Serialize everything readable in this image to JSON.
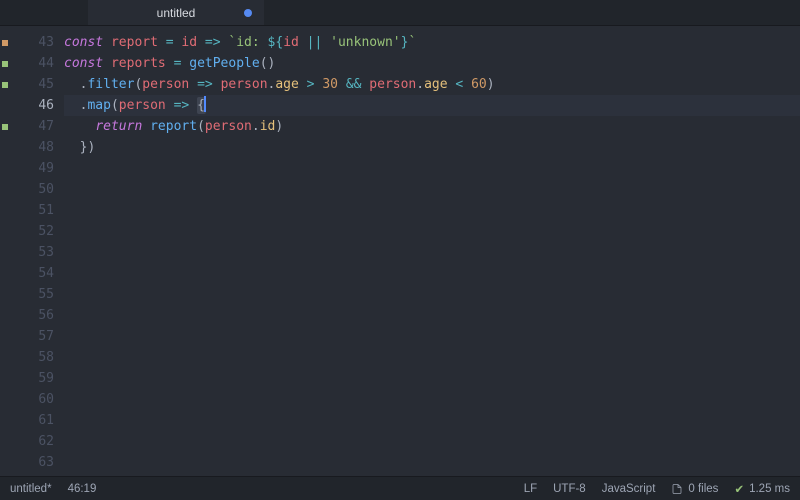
{
  "tab": {
    "title": "untitled",
    "modified": true
  },
  "gutter": {
    "start": 43,
    "end": 63,
    "active": 46,
    "markers": {
      "43": "#d19a66",
      "44": "#98c379",
      "45": "#98c379",
      "47": "#98c379"
    }
  },
  "code": {
    "lines": [
      {
        "n": 43,
        "tokens": [
          [
            "kw",
            "const"
          ],
          [
            "pn",
            " "
          ],
          [
            "vr",
            "report"
          ],
          [
            "pn",
            " "
          ],
          [
            "op",
            "="
          ],
          [
            "pn",
            " "
          ],
          [
            "vr",
            "id"
          ],
          [
            "pn",
            " "
          ],
          [
            "op",
            "=>"
          ],
          [
            "pn",
            " "
          ],
          [
            "st",
            "`id: "
          ],
          [
            "tm",
            "${"
          ],
          [
            "vr",
            "id"
          ],
          [
            "pn",
            " "
          ],
          [
            "op",
            "||"
          ],
          [
            "pn",
            " "
          ],
          [
            "st",
            "'unknown'"
          ],
          [
            "tm",
            "}"
          ],
          [
            "st",
            "`"
          ]
        ]
      },
      {
        "n": 44,
        "tokens": [
          [
            "kw",
            "const"
          ],
          [
            "pn",
            " "
          ],
          [
            "vr",
            "reports"
          ],
          [
            "pn",
            " "
          ],
          [
            "op",
            "="
          ],
          [
            "pn",
            " "
          ],
          [
            "fn",
            "getPeople"
          ],
          [
            "pn",
            "()"
          ]
        ]
      },
      {
        "n": 45,
        "tokens": [
          [
            "pn",
            "  "
          ],
          [
            "pn",
            "."
          ],
          [
            "fn",
            "filter"
          ],
          [
            "pn",
            "("
          ],
          [
            "vr",
            "person"
          ],
          [
            "pn",
            " "
          ],
          [
            "op",
            "=>"
          ],
          [
            "pn",
            " "
          ],
          [
            "vr",
            "person"
          ],
          [
            "pn",
            "."
          ],
          [
            "pr",
            "age"
          ],
          [
            "pn",
            " "
          ],
          [
            "op",
            ">"
          ],
          [
            "pn",
            " "
          ],
          [
            "nm",
            "30"
          ],
          [
            "pn",
            " "
          ],
          [
            "op",
            "&&"
          ],
          [
            "pn",
            " "
          ],
          [
            "vr",
            "person"
          ],
          [
            "pn",
            "."
          ],
          [
            "pr",
            "age"
          ],
          [
            "pn",
            " "
          ],
          [
            "op",
            "<"
          ],
          [
            "pn",
            " "
          ],
          [
            "nm",
            "60"
          ],
          [
            "pn",
            ")"
          ]
        ]
      },
      {
        "n": 46,
        "hl": true,
        "tokens": [
          [
            "pn",
            "  "
          ],
          [
            "pn",
            "."
          ],
          [
            "fn",
            "map"
          ],
          [
            "pn",
            "("
          ],
          [
            "vr",
            "person"
          ],
          [
            "pn",
            " "
          ],
          [
            "op",
            "=>"
          ],
          [
            "pn",
            " "
          ],
          [
            "sel-open",
            ""
          ],
          [
            "pn",
            "{"
          ],
          [
            "cursor",
            ""
          ],
          [
            "sel-close",
            ""
          ]
        ]
      },
      {
        "n": 47,
        "tokens": [
          [
            "pn",
            "    "
          ],
          [
            "kw",
            "return"
          ],
          [
            "pn",
            " "
          ],
          [
            "fn",
            "report"
          ],
          [
            "pn",
            "("
          ],
          [
            "vr",
            "person"
          ],
          [
            "pn",
            "."
          ],
          [
            "pr",
            "id"
          ],
          [
            "pn",
            ")"
          ]
        ]
      },
      {
        "n": 48,
        "tokens": [
          [
            "pn",
            "  "
          ],
          [
            "pn",
            "})"
          ]
        ]
      },
      {
        "n": 49,
        "tokens": []
      },
      {
        "n": 50,
        "tokens": []
      },
      {
        "n": 51,
        "tokens": []
      },
      {
        "n": 52,
        "tokens": []
      },
      {
        "n": 53,
        "tokens": []
      },
      {
        "n": 54,
        "tokens": []
      },
      {
        "n": 55,
        "tokens": []
      },
      {
        "n": 56,
        "tokens": []
      },
      {
        "n": 57,
        "tokens": []
      },
      {
        "n": 58,
        "tokens": []
      },
      {
        "n": 59,
        "tokens": []
      },
      {
        "n": 60,
        "tokens": []
      },
      {
        "n": 61,
        "tokens": []
      },
      {
        "n": 62,
        "tokens": []
      },
      {
        "n": 63,
        "tokens": []
      }
    ]
  },
  "status": {
    "file": "untitled*",
    "cursor": "46:19",
    "line_ending": "LF",
    "encoding": "UTF-8",
    "language": "JavaScript",
    "files_count": "0 files",
    "timing": "1.25 ms",
    "timing_icon": "✔"
  }
}
